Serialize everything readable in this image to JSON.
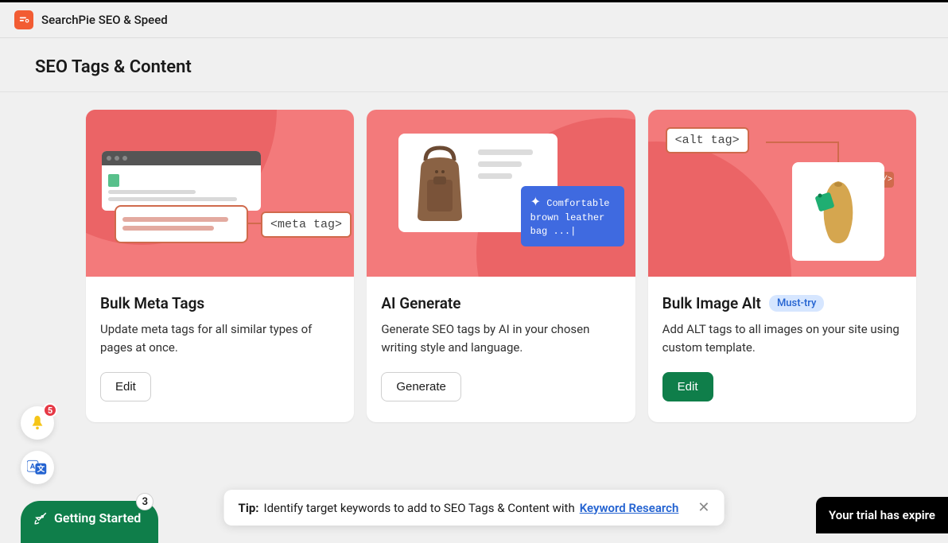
{
  "header": {
    "app_name": "SearchPie SEO & Speed"
  },
  "page": {
    "title": "SEO Tags & Content"
  },
  "cards": {
    "meta": {
      "title": "Bulk Meta Tags",
      "desc": "Update meta tags for all similar types of pages at once.",
      "button": "Edit",
      "tag_label": "<meta tag>"
    },
    "ai": {
      "title": "AI Generate",
      "desc": "Generate SEO tags by AI in your chosen writing style and language.",
      "button": "Generate",
      "bubble_text": "Comfortable brown leather bag ...|"
    },
    "alt": {
      "title": "Bulk Image Alt",
      "badge": "Must-try",
      "desc": "Add ALT tags to all images on your site using custom template.",
      "button": "Edit",
      "tag_label": "<alt tag>",
      "chip": "</>"
    }
  },
  "notif": {
    "count": "5"
  },
  "getting_started": {
    "label": "Getting Started",
    "count": "3"
  },
  "tip": {
    "label": "Tip:",
    "text": "Identify target keywords to add to SEO Tags & Content with ",
    "link": "Keyword Research"
  },
  "trial": {
    "text": "Your trial has expire"
  }
}
